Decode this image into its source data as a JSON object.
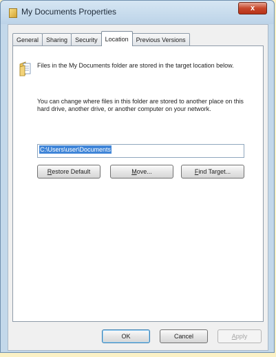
{
  "window": {
    "title": "My Documents Properties",
    "close_label": "x"
  },
  "tabs": [
    {
      "label": "General",
      "active": false
    },
    {
      "label": "Sharing",
      "active": false
    },
    {
      "label": "Security",
      "active": false
    },
    {
      "label": "Location",
      "active": true
    },
    {
      "label": "Previous Versions",
      "active": false
    }
  ],
  "location": {
    "description": "Files in the My Documents folder are stored in the target location below.",
    "help_text": "You can change where files in this folder are stored to another place on this hard drive, another drive, or another computer on your network.",
    "path_value": "C:\\Users\\user\\Documents",
    "restore_default": {
      "accel": "R",
      "rest": "estore Default"
    },
    "move": {
      "accel": "M",
      "rest": "ove..."
    },
    "find_target": {
      "accel": "F",
      "rest": "ind Target..."
    }
  },
  "footer": {
    "ok_label": "OK",
    "cancel_label": "Cancel",
    "apply": {
      "accel": "A",
      "rest": "pply"
    }
  },
  "colors": {
    "selection": "#3f85d8",
    "window_frame": "#c3d8ea",
    "close_button": "#c7472b"
  },
  "icons": {
    "title": "folder-icon",
    "location": "documents-folder-icon",
    "close": "close-icon"
  }
}
